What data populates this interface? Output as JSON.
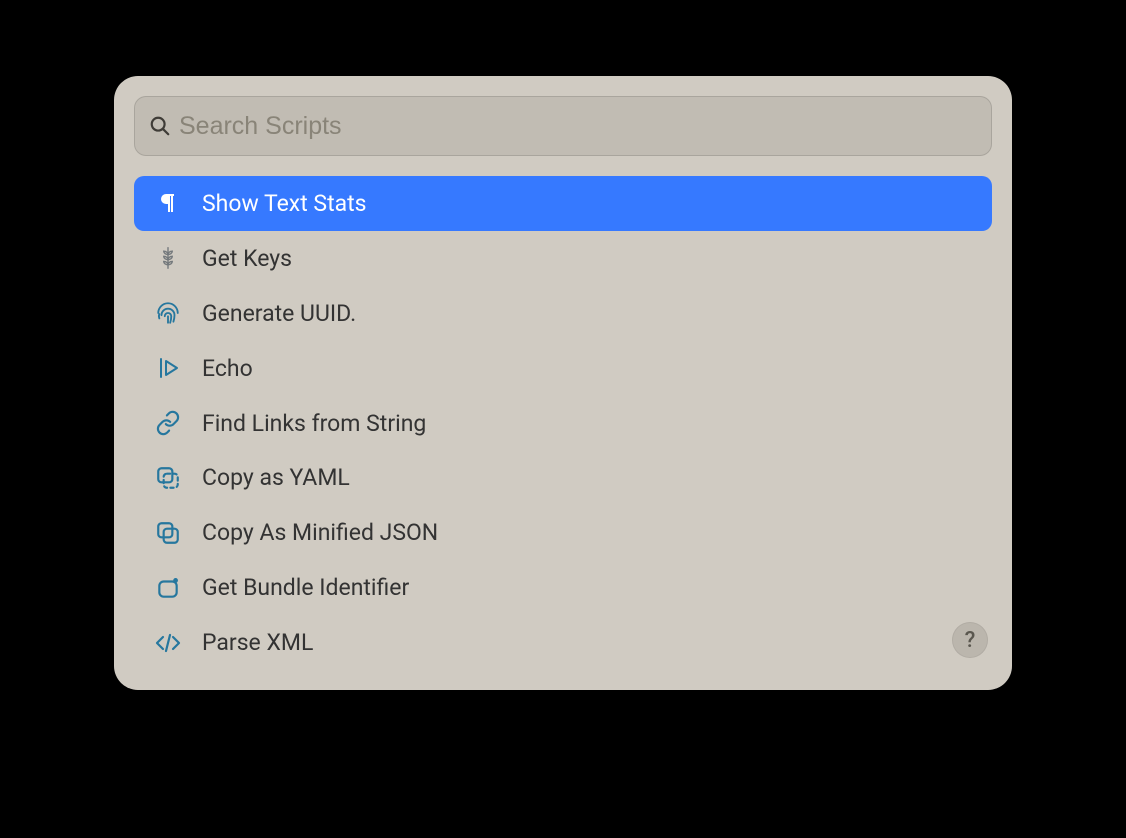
{
  "search": {
    "placeholder": "Search Scripts",
    "value": ""
  },
  "items": [
    {
      "label": "Show Text Stats",
      "icon": "pilcrow",
      "selected": true
    },
    {
      "label": "Get Keys",
      "icon": "wheat",
      "selected": false
    },
    {
      "label": "Generate UUID.",
      "icon": "fingerprint",
      "selected": false
    },
    {
      "label": "Echo",
      "icon": "play",
      "selected": false
    },
    {
      "label": "Find Links from String",
      "icon": "link",
      "selected": false
    },
    {
      "label": "Copy as YAML",
      "icon": "copy-dashed",
      "selected": false
    },
    {
      "label": "Copy As Minified JSON",
      "icon": "copy-solid",
      "selected": false
    },
    {
      "label": "Get Bundle Identifier",
      "icon": "box-dot",
      "selected": false
    },
    {
      "label": "Parse XML",
      "icon": "code",
      "selected": false
    }
  ],
  "help": {
    "label": "?"
  },
  "colors": {
    "panel_bg": "#d0cbc2",
    "selection": "#3679ff",
    "icon_teal": "#26779e"
  }
}
